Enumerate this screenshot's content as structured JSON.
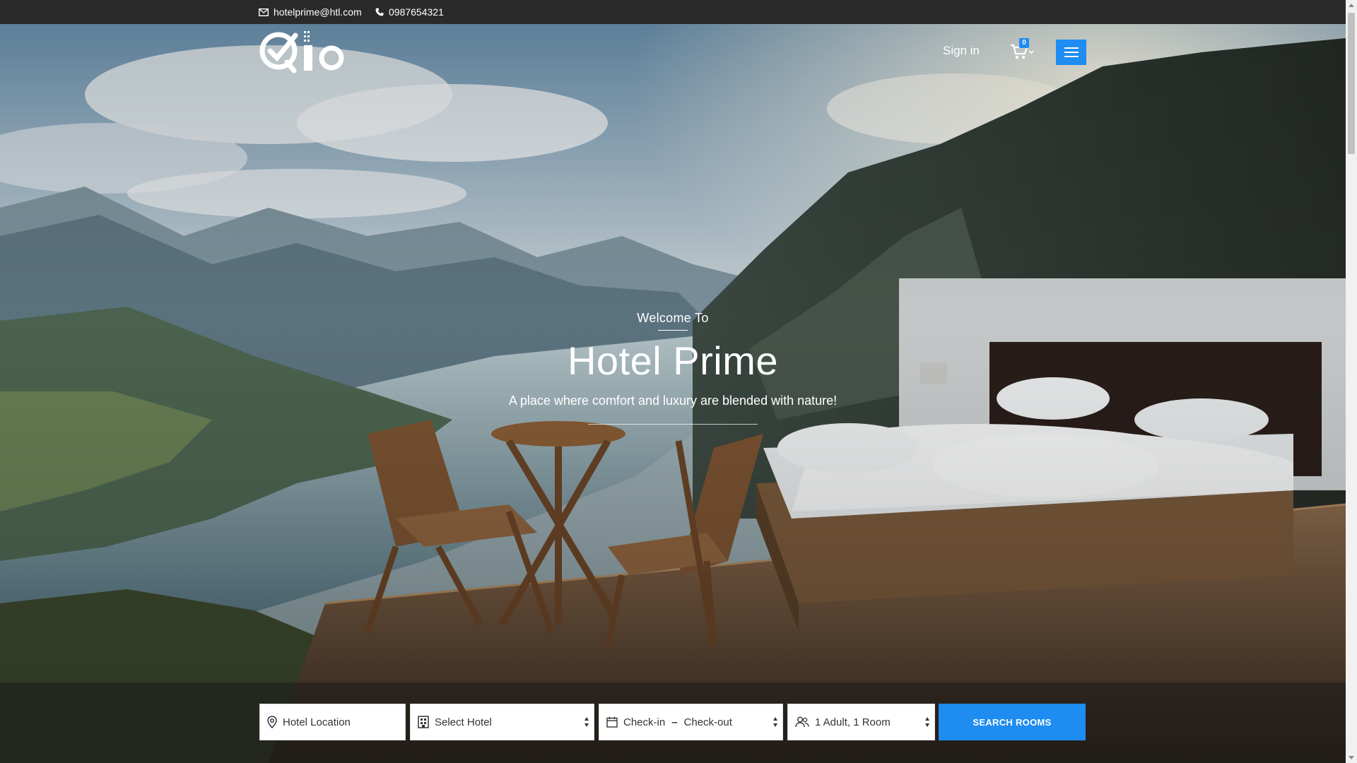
{
  "topbar": {
    "email": "hotelprime@htl.com",
    "phone": "0987654321"
  },
  "header": {
    "logo_text": "Qlo",
    "signin_label": "Sign in",
    "cart_count": "0"
  },
  "hero": {
    "welcome": "Welcome To",
    "hotel_name": "Hotel Prime",
    "tagline": "A place where comfort and luxury are blended with nature!"
  },
  "search": {
    "location_placeholder": "Hotel Location",
    "hotel_select": "Select Hotel",
    "checkin": "Check-in",
    "checkout": "Check-out",
    "guests": "1 Adult, 1 Room",
    "button_label": "SEARCH ROOMS"
  },
  "colors": {
    "accent": "#1e8cf0",
    "topbar": "#2a2a2a"
  },
  "icons": {
    "email": "envelope-icon",
    "phone": "phone-icon",
    "cart": "cart-icon",
    "menu": "hamburger-icon",
    "location": "map-pin-icon",
    "hotel": "building-icon",
    "calendar": "calendar-icon",
    "guests": "users-icon"
  }
}
